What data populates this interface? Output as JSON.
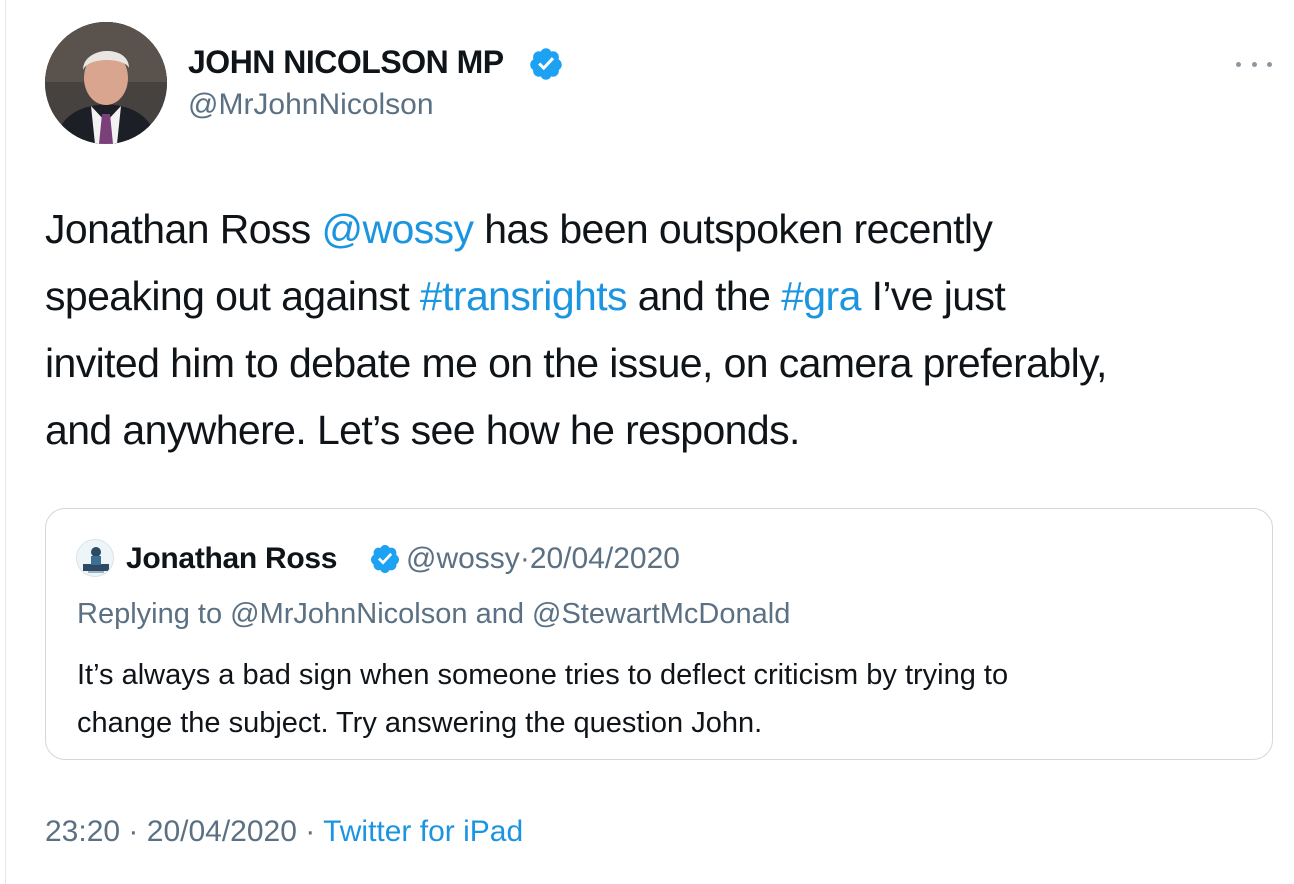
{
  "author": {
    "name": "JOHN NICOLSON MP",
    "handle": "@MrJohnNicolson",
    "verified": true
  },
  "tweet": {
    "lines": [
      [
        {
          "t": "Jonathan Ross ",
          "link": false
        },
        {
          "t": "@wossy",
          "link": true
        },
        {
          "t": " has been outspoken recently",
          "link": false
        }
      ],
      [
        {
          "t": "speaking out against ",
          "link": false
        },
        {
          "t": "#transrights",
          "link": true
        },
        {
          "t": " and the ",
          "link": false
        },
        {
          "t": "#gra",
          "link": true
        },
        {
          "t": " I’ve just",
          "link": false
        }
      ],
      [
        {
          "t": "invited him to debate me on the issue, on camera preferably,",
          "link": false
        }
      ],
      [
        {
          "t": "and anywhere. Let’s see how he responds.",
          "link": false
        }
      ]
    ]
  },
  "quoted": {
    "name": "Jonathan Ross",
    "handle": "@wossy",
    "separator": "·",
    "date": "20/04/2020",
    "reply_prefix": "Replying to ",
    "reply_user1": "@MrJohnNicolson",
    "reply_and": " and ",
    "reply_user2": "@StewartMcDonald",
    "body_lines": [
      "It’s always a bad sign when someone tries to deflect criticism by trying to",
      "change the subject. Try answering the question John."
    ]
  },
  "footer": {
    "time": "23:20",
    "separator": "·",
    "date": "20/04/2020",
    "source": "Twitter for iPad"
  },
  "colors": {
    "link": "#1b95e0",
    "secondary_text": "#5b7083",
    "primary_text": "#0f1419",
    "verified_badge": "#1da1f2",
    "border": "#cfd9de"
  },
  "icons": {
    "verified": "verified-badge-icon",
    "more": "more-horizontal-icon"
  }
}
